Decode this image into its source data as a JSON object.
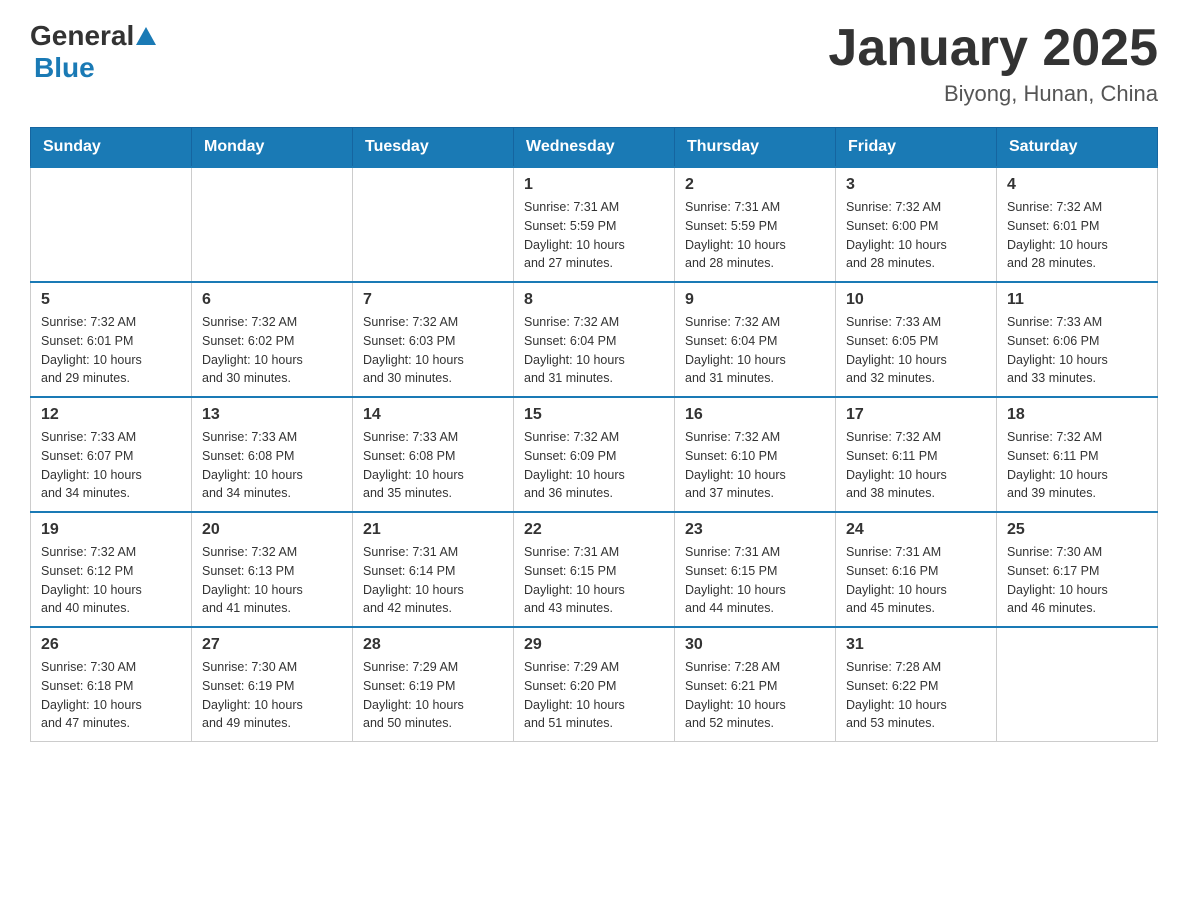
{
  "header": {
    "logo_general": "General",
    "logo_blue": "Blue",
    "month_title": "January 2025",
    "location": "Biyong, Hunan, China"
  },
  "days_of_week": [
    "Sunday",
    "Monday",
    "Tuesday",
    "Wednesday",
    "Thursday",
    "Friday",
    "Saturday"
  ],
  "weeks": [
    [
      {
        "day": "",
        "info": ""
      },
      {
        "day": "",
        "info": ""
      },
      {
        "day": "",
        "info": ""
      },
      {
        "day": "1",
        "info": "Sunrise: 7:31 AM\nSunset: 5:59 PM\nDaylight: 10 hours\nand 27 minutes."
      },
      {
        "day": "2",
        "info": "Sunrise: 7:31 AM\nSunset: 5:59 PM\nDaylight: 10 hours\nand 28 minutes."
      },
      {
        "day": "3",
        "info": "Sunrise: 7:32 AM\nSunset: 6:00 PM\nDaylight: 10 hours\nand 28 minutes."
      },
      {
        "day": "4",
        "info": "Sunrise: 7:32 AM\nSunset: 6:01 PM\nDaylight: 10 hours\nand 28 minutes."
      }
    ],
    [
      {
        "day": "5",
        "info": "Sunrise: 7:32 AM\nSunset: 6:01 PM\nDaylight: 10 hours\nand 29 minutes."
      },
      {
        "day": "6",
        "info": "Sunrise: 7:32 AM\nSunset: 6:02 PM\nDaylight: 10 hours\nand 30 minutes."
      },
      {
        "day": "7",
        "info": "Sunrise: 7:32 AM\nSunset: 6:03 PM\nDaylight: 10 hours\nand 30 minutes."
      },
      {
        "day": "8",
        "info": "Sunrise: 7:32 AM\nSunset: 6:04 PM\nDaylight: 10 hours\nand 31 minutes."
      },
      {
        "day": "9",
        "info": "Sunrise: 7:32 AM\nSunset: 6:04 PM\nDaylight: 10 hours\nand 31 minutes."
      },
      {
        "day": "10",
        "info": "Sunrise: 7:33 AM\nSunset: 6:05 PM\nDaylight: 10 hours\nand 32 minutes."
      },
      {
        "day": "11",
        "info": "Sunrise: 7:33 AM\nSunset: 6:06 PM\nDaylight: 10 hours\nand 33 minutes."
      }
    ],
    [
      {
        "day": "12",
        "info": "Sunrise: 7:33 AM\nSunset: 6:07 PM\nDaylight: 10 hours\nand 34 minutes."
      },
      {
        "day": "13",
        "info": "Sunrise: 7:33 AM\nSunset: 6:08 PM\nDaylight: 10 hours\nand 34 minutes."
      },
      {
        "day": "14",
        "info": "Sunrise: 7:33 AM\nSunset: 6:08 PM\nDaylight: 10 hours\nand 35 minutes."
      },
      {
        "day": "15",
        "info": "Sunrise: 7:32 AM\nSunset: 6:09 PM\nDaylight: 10 hours\nand 36 minutes."
      },
      {
        "day": "16",
        "info": "Sunrise: 7:32 AM\nSunset: 6:10 PM\nDaylight: 10 hours\nand 37 minutes."
      },
      {
        "day": "17",
        "info": "Sunrise: 7:32 AM\nSunset: 6:11 PM\nDaylight: 10 hours\nand 38 minutes."
      },
      {
        "day": "18",
        "info": "Sunrise: 7:32 AM\nSunset: 6:11 PM\nDaylight: 10 hours\nand 39 minutes."
      }
    ],
    [
      {
        "day": "19",
        "info": "Sunrise: 7:32 AM\nSunset: 6:12 PM\nDaylight: 10 hours\nand 40 minutes."
      },
      {
        "day": "20",
        "info": "Sunrise: 7:32 AM\nSunset: 6:13 PM\nDaylight: 10 hours\nand 41 minutes."
      },
      {
        "day": "21",
        "info": "Sunrise: 7:31 AM\nSunset: 6:14 PM\nDaylight: 10 hours\nand 42 minutes."
      },
      {
        "day": "22",
        "info": "Sunrise: 7:31 AM\nSunset: 6:15 PM\nDaylight: 10 hours\nand 43 minutes."
      },
      {
        "day": "23",
        "info": "Sunrise: 7:31 AM\nSunset: 6:15 PM\nDaylight: 10 hours\nand 44 minutes."
      },
      {
        "day": "24",
        "info": "Sunrise: 7:31 AM\nSunset: 6:16 PM\nDaylight: 10 hours\nand 45 minutes."
      },
      {
        "day": "25",
        "info": "Sunrise: 7:30 AM\nSunset: 6:17 PM\nDaylight: 10 hours\nand 46 minutes."
      }
    ],
    [
      {
        "day": "26",
        "info": "Sunrise: 7:30 AM\nSunset: 6:18 PM\nDaylight: 10 hours\nand 47 minutes."
      },
      {
        "day": "27",
        "info": "Sunrise: 7:30 AM\nSunset: 6:19 PM\nDaylight: 10 hours\nand 49 minutes."
      },
      {
        "day": "28",
        "info": "Sunrise: 7:29 AM\nSunset: 6:19 PM\nDaylight: 10 hours\nand 50 minutes."
      },
      {
        "day": "29",
        "info": "Sunrise: 7:29 AM\nSunset: 6:20 PM\nDaylight: 10 hours\nand 51 minutes."
      },
      {
        "day": "30",
        "info": "Sunrise: 7:28 AM\nSunset: 6:21 PM\nDaylight: 10 hours\nand 52 minutes."
      },
      {
        "day": "31",
        "info": "Sunrise: 7:28 AM\nSunset: 6:22 PM\nDaylight: 10 hours\nand 53 minutes."
      },
      {
        "day": "",
        "info": ""
      }
    ]
  ]
}
